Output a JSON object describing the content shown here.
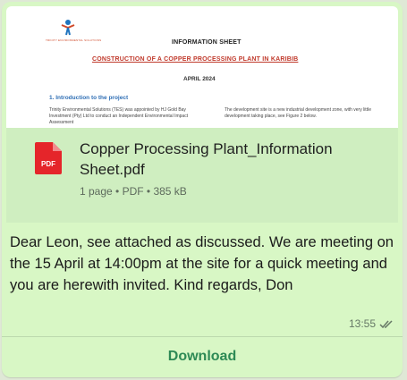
{
  "document_preview": {
    "logo_caption": "TRINITY ENVIRONMENTAL SOLUTIONS",
    "header": "INFORMATION SHEET",
    "subtitle": "CONSTRUCTION OF A COPPER PROCESSING PLANT IN KARIBIB",
    "date": "APRIL 2024",
    "section_heading": "1. Introduction to the project",
    "column_left": "Trinity Environmental Solutions (TES) was appointed by HJ Gold Bay Investment (Pty) Ltd to conduct an Independent Environmental Impact Assessment",
    "column_right": "The development site is a new industrial development zone, with very little development taking place, see Figure 2 below."
  },
  "file": {
    "icon_label": "PDF",
    "name": "Copper Processing Plant_Information Sheet.pdf",
    "meta": "1 page • PDF • 385 kB"
  },
  "message": {
    "text": "Dear Leon, see attached as discussed. We are meeting on the 15 April at 14:00pm at the site for a quick meeting and you are herewith invited.  Kind regards,  Don",
    "time": "13:55"
  },
  "actions": {
    "download_label": "Download"
  },
  "colors": {
    "bubble": "#d8f7c5",
    "file_band": "#cfeec0",
    "pdf_red": "#e5252a",
    "download_green": "#2d8a55",
    "ticks": "#667866"
  }
}
